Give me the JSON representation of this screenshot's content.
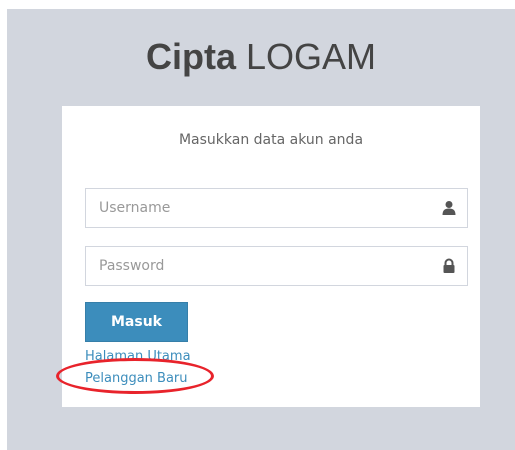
{
  "header": {
    "brand_bold": "Cipta",
    "brand_light": "LOGAM"
  },
  "login_box": {
    "message": "Masukkan data akun anda",
    "username": {
      "placeholder": "Username",
      "value": "",
      "icon": "user-icon"
    },
    "password": {
      "placeholder": "Password",
      "value": "",
      "icon": "lock-icon"
    },
    "submit_label": "Masuk",
    "links": {
      "home": "Halaman Utama",
      "new_customer": "Pelanggan Baru"
    }
  },
  "annotation": {
    "highlight_color": "#e8232b",
    "highlight_target": "Pelanggan Baru"
  },
  "colors": {
    "background": "#d2d6de",
    "accent": "#3c8dbc",
    "box": "#ffffff"
  }
}
